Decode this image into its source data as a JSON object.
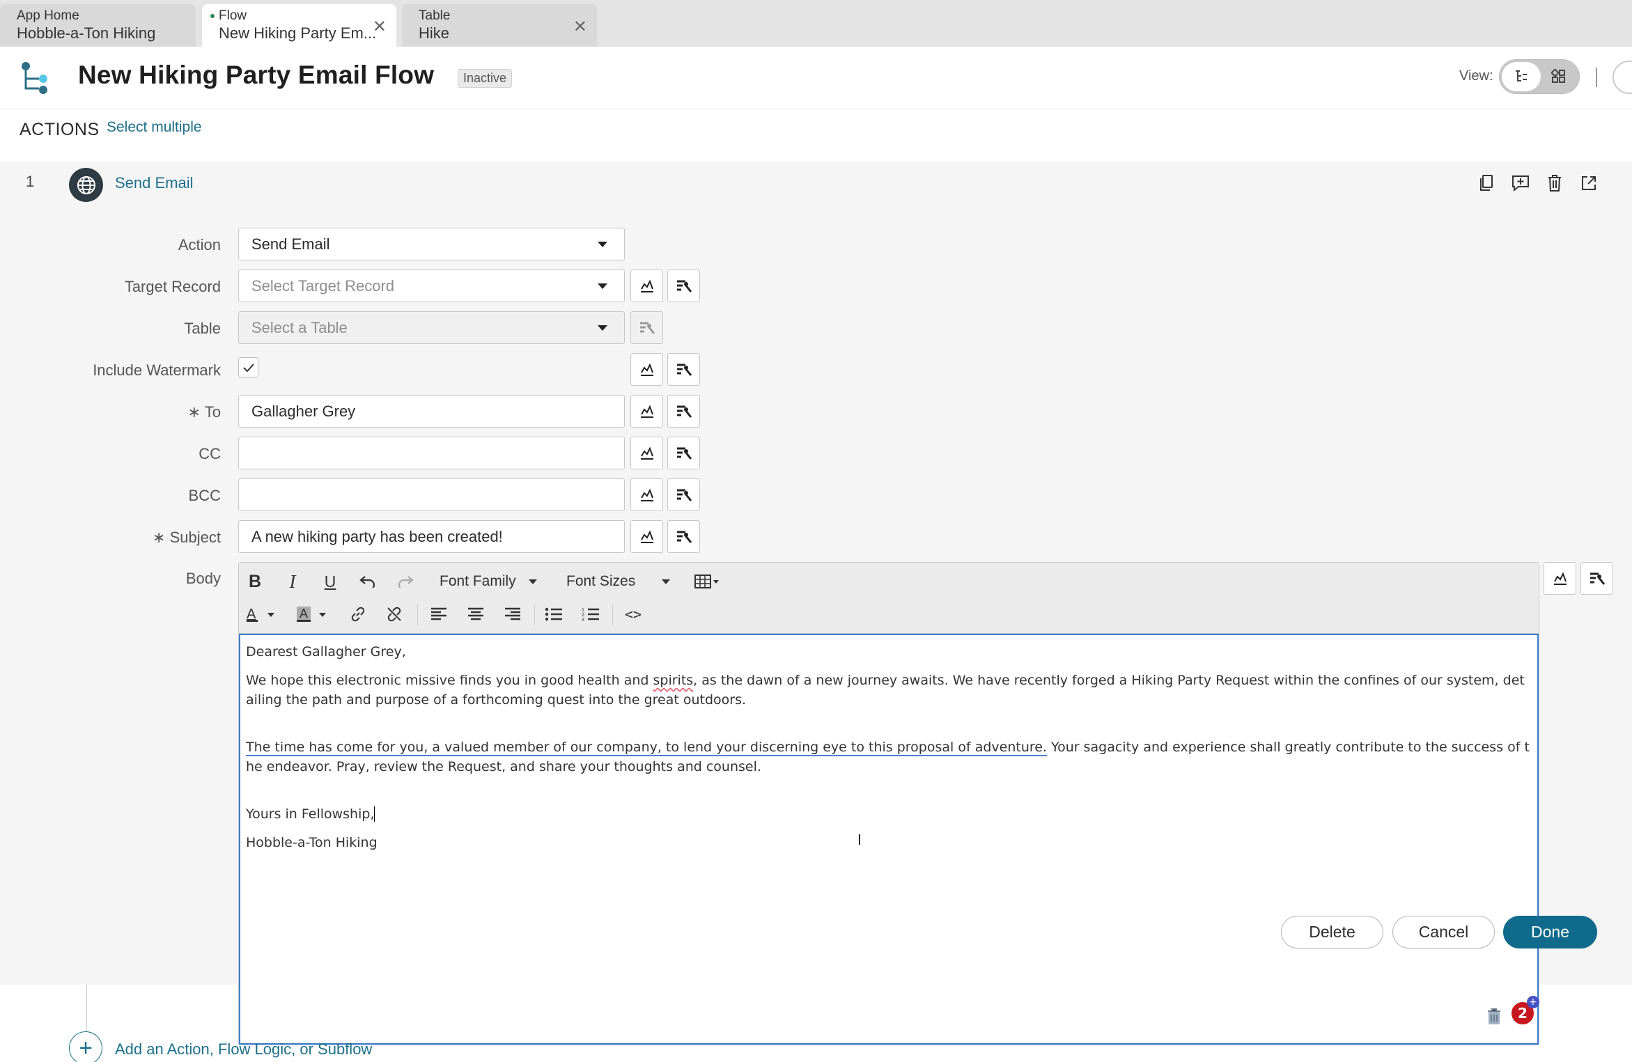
{
  "tabs": [
    {
      "type": "App Home",
      "label": "Hobble-a-Ton Hiking",
      "active": false
    },
    {
      "type": "Flow",
      "label": "New Hiking Party Em...",
      "active": true,
      "close": "✕"
    },
    {
      "type": "Table",
      "label": "Hike",
      "active": false,
      "close": "✕"
    }
  ],
  "header": {
    "title": "New Hiking Party Email Flow",
    "status": "Inactive",
    "view_label": "View:"
  },
  "actions_bar": {
    "label": "ACTIONS",
    "select_multiple": "Select multiple"
  },
  "step": {
    "number": "1",
    "title": "Send Email",
    "icon": "globe-icon",
    "tools": [
      "copy-icon",
      "comment-icon",
      "trash-icon",
      "open-external-icon"
    ]
  },
  "form": {
    "action": {
      "label": "Action",
      "value": "Send Email"
    },
    "target_record": {
      "label": "Target Record",
      "placeholder": "Select Target Record"
    },
    "table": {
      "label": "Table",
      "placeholder": "Select a Table"
    },
    "watermark": {
      "label": "Include Watermark",
      "checked": true
    },
    "to": {
      "label": "To",
      "required_mark": "∗",
      "value": "Gallagher Grey"
    },
    "cc": {
      "label": "CC",
      "value": ""
    },
    "bcc": {
      "label": "BCC",
      "value": ""
    },
    "subject": {
      "label": "Subject",
      "required_mark": "∗",
      "value": "A new hiking party has been created!"
    },
    "body": {
      "label": "Body"
    }
  },
  "editor": {
    "toolbar": {
      "bold": "B",
      "italic": "I",
      "underline": "U",
      "font_family": "Font Family",
      "font_sizes": "Font Sizes",
      "code": "<>"
    },
    "content": {
      "greeting": "Dearest Gallagher Grey,",
      "p1_a": "We hope this electronic missive finds you in good health and ",
      "p1_spell": "spirits",
      "p1_b": ", as the dawn of a new journey awaits. We have recently forged a Hiking Party Request within the confines of our system, detailing the path and purpose of a forthcoming quest into the great outdoors.",
      "p2_a": "The time has come for you, a valued member of our company, to lend your discerning eye to this proposal of adventure.",
      "p2_b": " Your sagacity and experience shall greatly contribute to the success of the endeavor. Pray, review the Request, and share your thoughts and counsel.",
      "closing": "Yours in Fellowship,",
      "signature": "Hobble-a-Ton Hiking"
    },
    "notification_count": "2"
  },
  "buttons": {
    "delete": "Delete",
    "cancel": "Cancel",
    "done": "Done"
  },
  "add_action": {
    "label": "Add an Action, Flow Logic, or Subflow",
    "icon": "plus-icon"
  },
  "colors": {
    "accent": "#1d6f8a",
    "primary_button": "#0f6a8b",
    "badge": "#c8171e",
    "editor_focus": "#3a7fd1"
  }
}
